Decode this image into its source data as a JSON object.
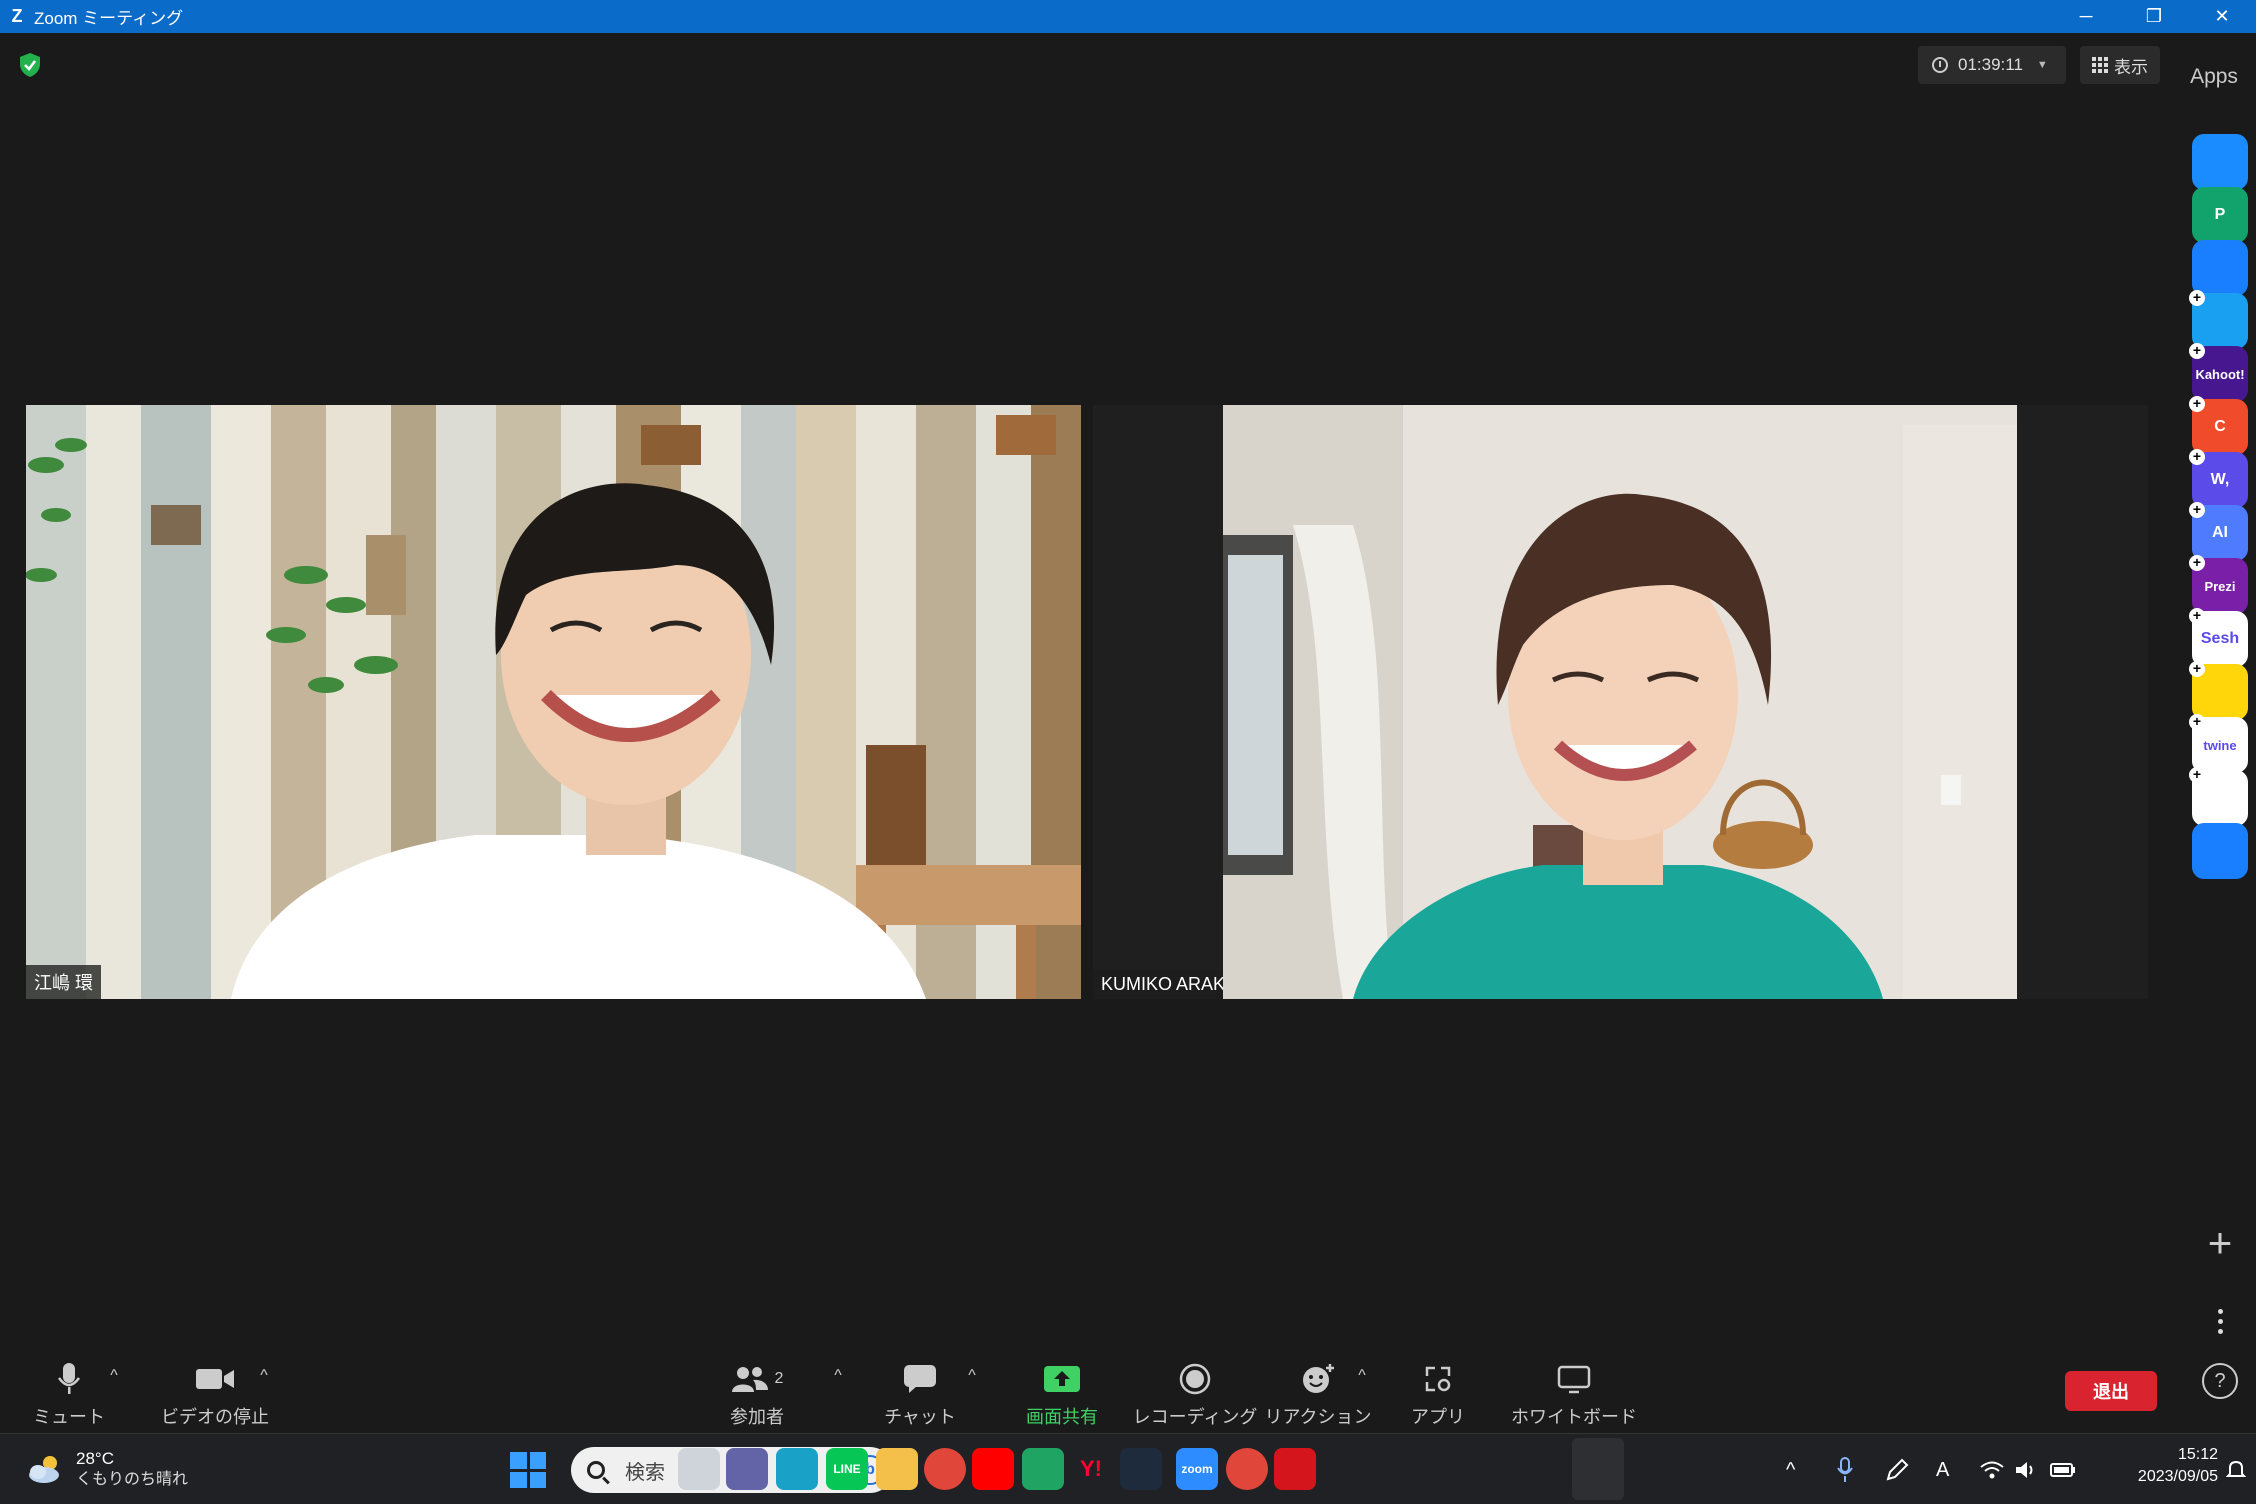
{
  "window": {
    "logo_letter": "Z",
    "title": "Zoom ミーティング",
    "minimize_glyph": "─",
    "restore_glyph": "❐",
    "close_glyph": "✕"
  },
  "meeting": {
    "elapsed_time": "01:39:11",
    "view_label": "表示"
  },
  "participants": [
    {
      "name": "江嶋 環"
    },
    {
      "name": "KUMIKO ARAKAWA"
    }
  ],
  "apps_panel": {
    "title": "Apps",
    "apps": [
      {
        "name": "smile-app",
        "label": "",
        "color": "#1a8cff",
        "addable": false
      },
      {
        "name": "p-app",
        "label": "P",
        "color": "#12a36c",
        "addable": false
      },
      {
        "name": "timer-app",
        "label": "",
        "color": "#1a7fff",
        "addable": false
      },
      {
        "name": "flag-app",
        "label": "",
        "color": "#1aa0f0",
        "addable": true
      },
      {
        "name": "kahoot-app",
        "label": "Kahoot!",
        "color": "#46178f",
        "addable": true
      },
      {
        "name": "c-app",
        "label": "C",
        "color": "#f04b2b",
        "addable": true
      },
      {
        "name": "wooclap-app",
        "label": "W,",
        "color": "#5b4be8",
        "addable": true
      },
      {
        "name": "ai-app",
        "label": "AI",
        "color": "#4f7bff",
        "addable": true
      },
      {
        "name": "prezi-app",
        "label": "Prezi",
        "color": "#7a1fa8",
        "addable": true
      },
      {
        "name": "sesh-app",
        "label": "Sesh",
        "color": "#ffffff",
        "addable": true
      },
      {
        "name": "emoji-app",
        "label": "",
        "color": "#ffd60a",
        "addable": true
      },
      {
        "name": "twine-app",
        "label": "twine",
        "color": "#ffffff",
        "addable": true
      },
      {
        "name": "blocks-app",
        "label": "",
        "color": "#ffffff",
        "addable": true
      },
      {
        "name": "stopwatch-app",
        "label": "",
        "color": "#1a7fff",
        "addable": false
      }
    ],
    "add_glyph": "+",
    "help_glyph": "?"
  },
  "controls": {
    "mute": "ミュート",
    "stop_video": "ビデオの停止",
    "participants": "参加者",
    "participants_count": "2",
    "chat": "チャット",
    "share_screen": "画面共有",
    "recording": "レコーディング",
    "reactions": "リアクション",
    "apps": "アプリ",
    "whiteboard": "ホワイトボード",
    "leave": "退出",
    "caret": "^"
  },
  "taskbar": {
    "weather_temp": "28°C",
    "weather_condition": "くもりのち晴れ",
    "search_placeholder": "検索",
    "bing_glyph": "b",
    "time": "15:12",
    "date": "2023/09/05",
    "tray_chevron": "^",
    "tray_font": "A",
    "apps": [
      {
        "name": "task-view",
        "label": "",
        "color": "#cfd4da"
      },
      {
        "name": "teams-chat",
        "label": "",
        "color": "#6264a7"
      },
      {
        "name": "edge",
        "label": "",
        "color": "#1aa1c8"
      },
      {
        "name": "line",
        "label": "LINE",
        "color": "#06c755"
      },
      {
        "name": "file-explorer",
        "label": "",
        "color": "#f5c04a"
      },
      {
        "name": "chrome",
        "label": "",
        "color": "#e0463a"
      },
      {
        "name": "youtube",
        "label": "",
        "color": "#ff0000"
      },
      {
        "name": "google-chat",
        "label": "",
        "color": "#1fa463"
      },
      {
        "name": "yahoo",
        "label": "Y!",
        "color": "#202124"
      },
      {
        "name": "dev-app",
        "label": "",
        "color": "#1e2b3c"
      },
      {
        "name": "zoom",
        "label": "zoom",
        "color": "#2d8cff"
      },
      {
        "name": "chrome-profile",
        "label": "",
        "color": "#e0463a"
      },
      {
        "name": "acrobat",
        "label": "",
        "color": "#d4151b"
      }
    ]
  }
}
